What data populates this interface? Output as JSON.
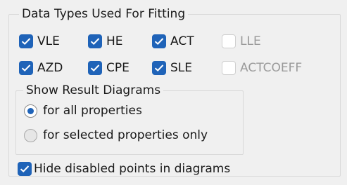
{
  "data_types": {
    "legend": "Data Types Used For Fitting",
    "items": [
      {
        "label": "VLE",
        "checked": true,
        "enabled": true
      },
      {
        "label": "HE",
        "checked": true,
        "enabled": true
      },
      {
        "label": "ACT",
        "checked": true,
        "enabled": true
      },
      {
        "label": "LLE",
        "checked": false,
        "enabled": false
      },
      {
        "label": "AZD",
        "checked": true,
        "enabled": true
      },
      {
        "label": "CPE",
        "checked": true,
        "enabled": true
      },
      {
        "label": "SLE",
        "checked": true,
        "enabled": true
      },
      {
        "label": "ACTCOEFF",
        "checked": false,
        "enabled": false
      }
    ]
  },
  "result_diagrams": {
    "legend": "Show Result Diagrams",
    "options": [
      {
        "label": "for all properties",
        "selected": true
      },
      {
        "label": "for selected properties only",
        "selected": false
      }
    ]
  },
  "hide_disabled": {
    "label": "Hide disabled points in diagrams",
    "checked": true
  },
  "colors": {
    "accent": "#1f63b8",
    "panel_bg": "#f0f0f0",
    "disabled_text": "#9a9a9a"
  }
}
